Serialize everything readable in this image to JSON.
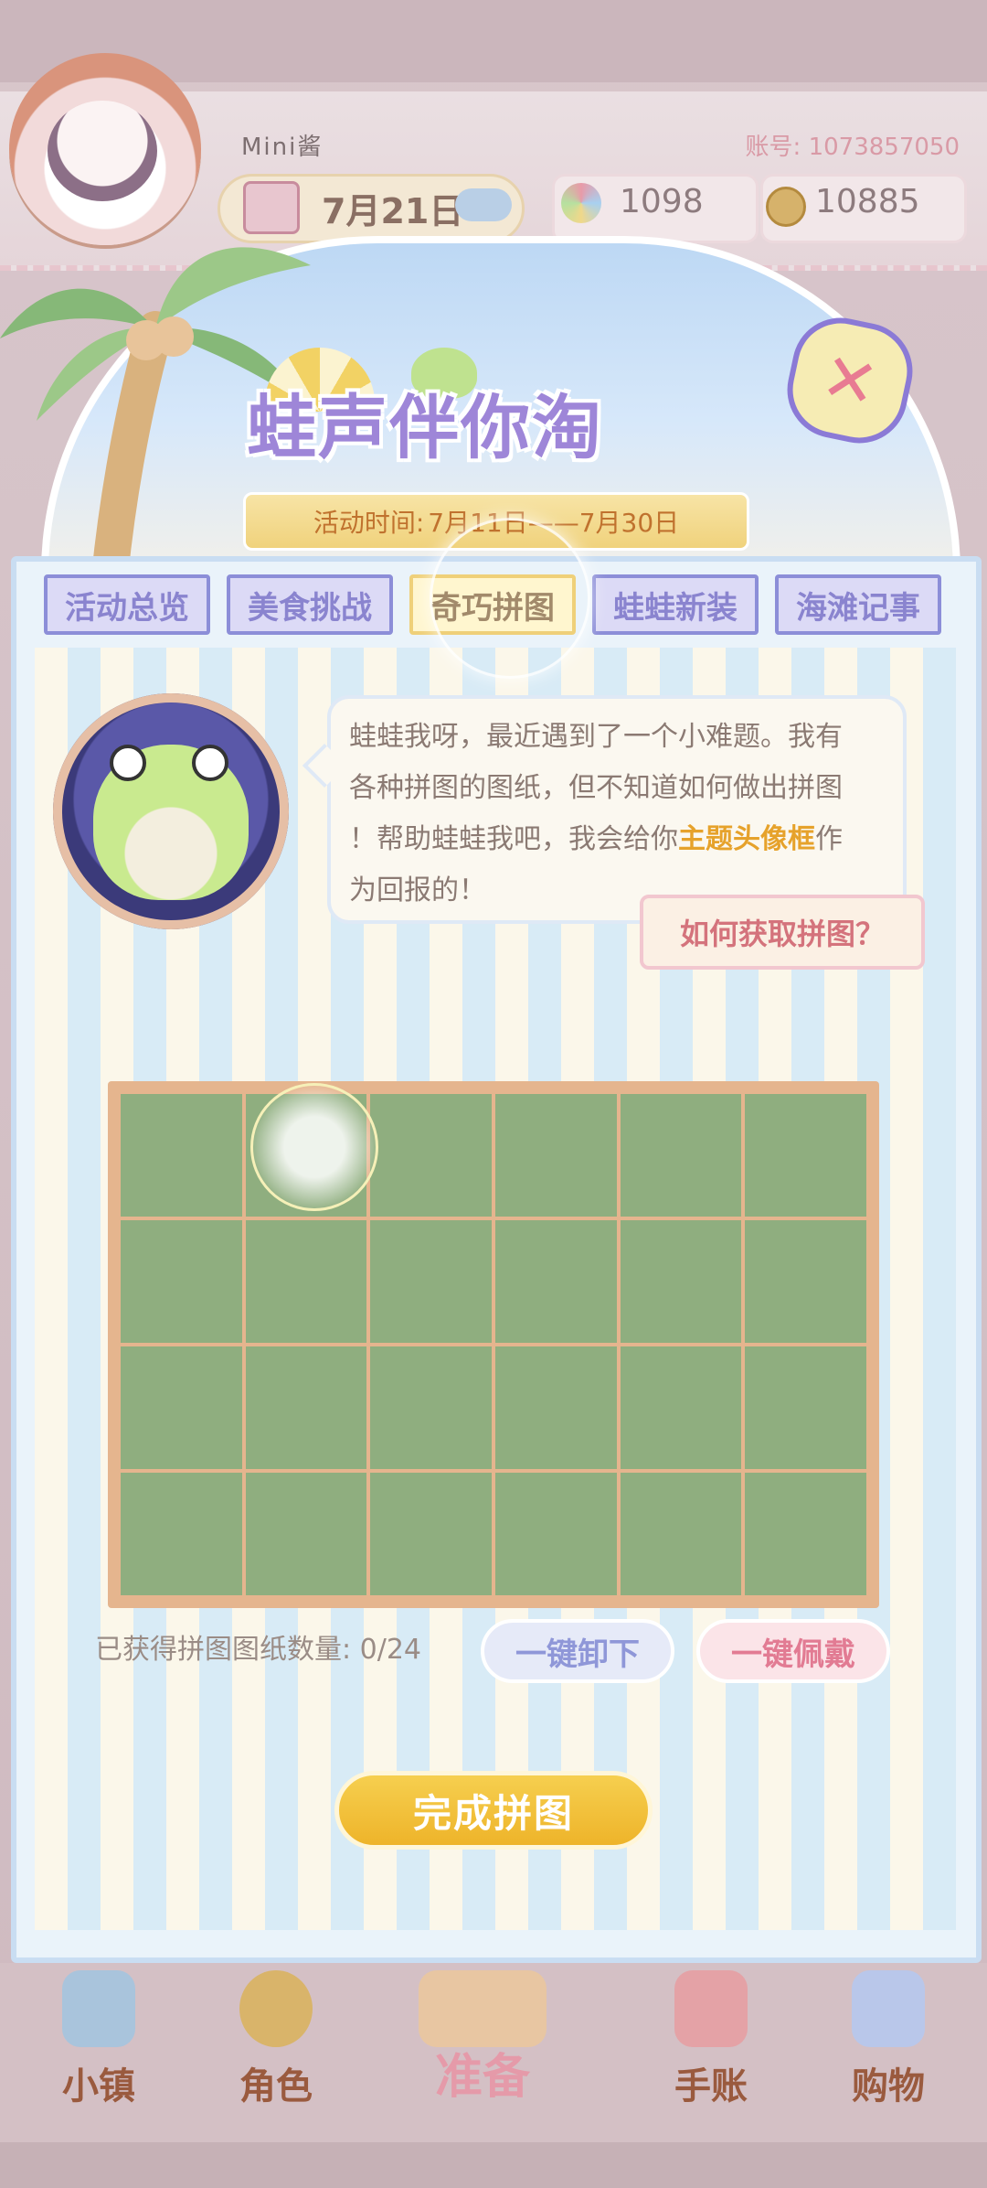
{
  "header": {
    "player_name": "Mini酱",
    "account": "账号: 1073857050",
    "date": "7月21日",
    "gems": "1098",
    "coins": "10885"
  },
  "banner": {
    "title": "蛙声伴你淘",
    "time_label": "活动时间:",
    "time_range": "7月11日——7月30日"
  },
  "tabs": [
    {
      "label": "活动总览"
    },
    {
      "label": "美食挑战"
    },
    {
      "label": "奇巧拼图"
    },
    {
      "label": "蛙蛙新装"
    },
    {
      "label": "海滩记事"
    }
  ],
  "active_tab": "奇巧拼图",
  "npc": {
    "line1": "蛙蛙我呀，最近遇到了一个小难题。我有",
    "line2": "各种拼图的图纸，但不知道如何做出拼图",
    "line3_pre": "！帮助蛙蛙我吧，我会给你",
    "line3_highlight": "主题头像框",
    "line3_post": "作",
    "line4": "为回报的！"
  },
  "howto_button": "如何获取拼图？",
  "puzzle": {
    "rows": 4,
    "cols": 6,
    "count_label": "已获得拼图图纸数量: 0/24"
  },
  "buttons": {
    "unload": "一键卸下",
    "wear": "一键佩戴",
    "complete": "完成拼图"
  },
  "bottom_nav": [
    {
      "label": "小镇"
    },
    {
      "label": "角色"
    },
    {
      "label": "准备"
    },
    {
      "label": "手账"
    },
    {
      "label": "购物"
    }
  ],
  "colors": {
    "tab_border": "#8c8ed8",
    "active_tab_bg": "#fff6cf",
    "grid_cell": "#8fae7f",
    "grid_frame": "#e5b58e",
    "highlight_text": "#e6a22b",
    "complete_button": "#f2c23c"
  }
}
